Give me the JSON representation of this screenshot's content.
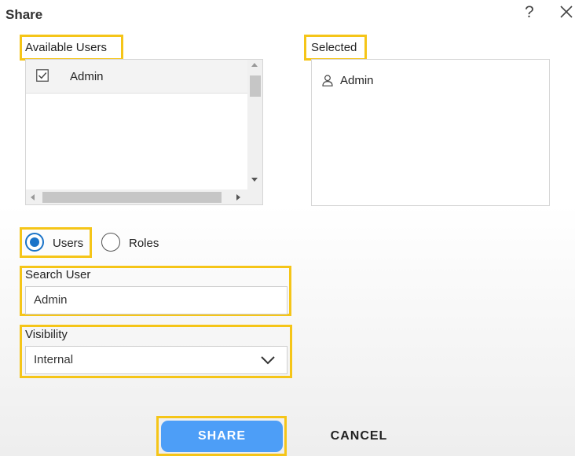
{
  "dialog": {
    "title": "Share",
    "help_icon": "?",
    "close_icon": "close-icon"
  },
  "available_users": {
    "label": "Available Users",
    "items": [
      {
        "name": "Admin",
        "checked": true
      }
    ]
  },
  "selected": {
    "label": "Selected",
    "items": [
      {
        "name": "Admin",
        "icon": "user-icon"
      }
    ]
  },
  "mode": {
    "options": [
      {
        "label": "Users",
        "selected": true
      },
      {
        "label": "Roles",
        "selected": false
      }
    ]
  },
  "search": {
    "label": "Search User",
    "value": "Admin"
  },
  "visibility": {
    "label": "Visibility",
    "value": "Internal"
  },
  "actions": {
    "share_label": "SHARE",
    "cancel_label": "CANCEL"
  },
  "colors": {
    "highlight": "#f5c518",
    "primary": "#4d9ef7",
    "radio_accent": "#1a73c8"
  }
}
